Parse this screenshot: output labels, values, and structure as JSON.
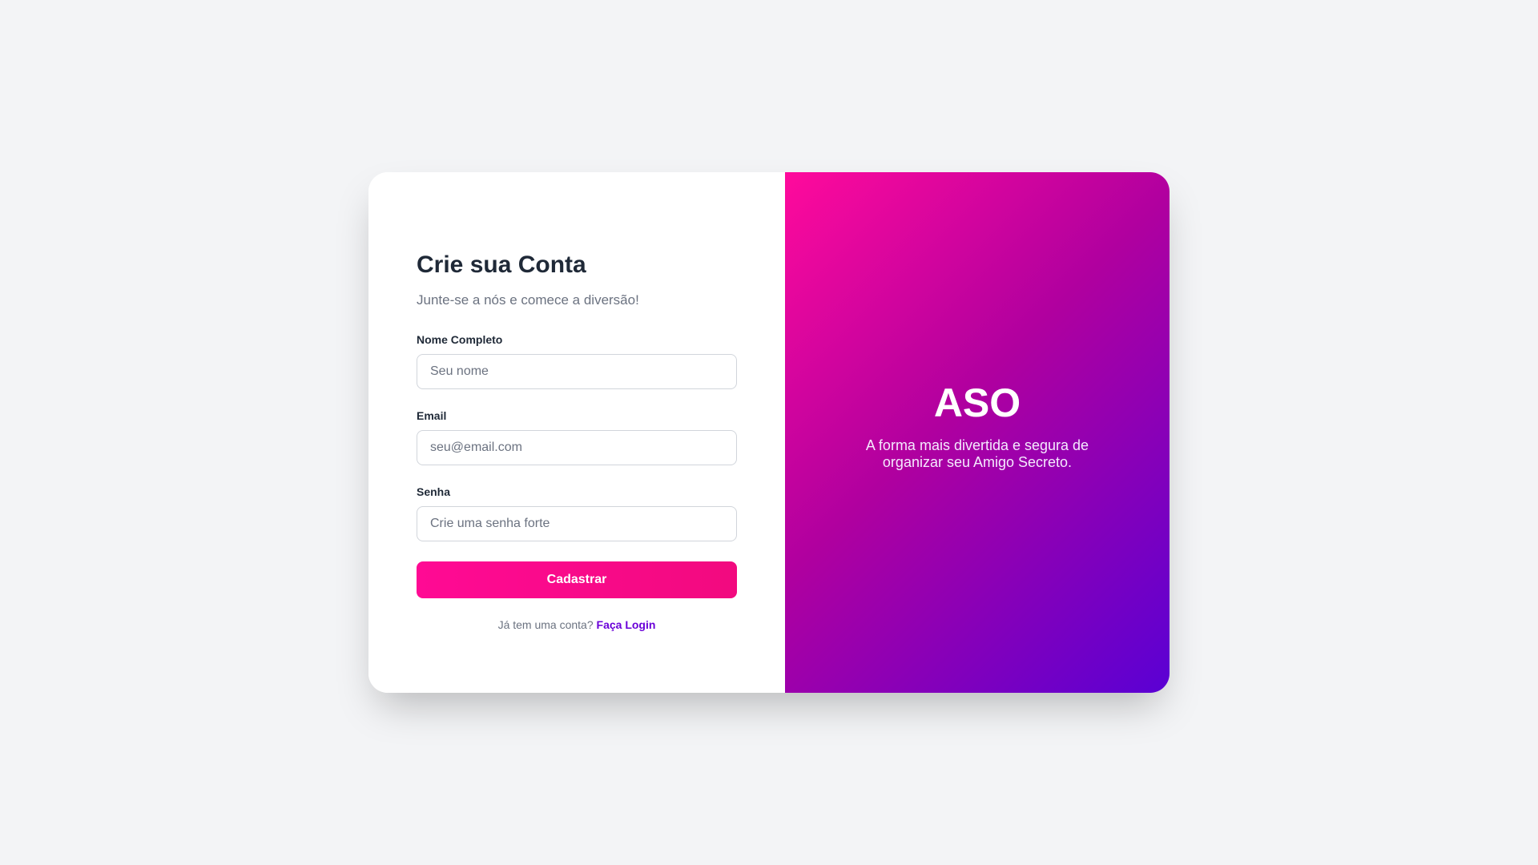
{
  "form": {
    "title": "Crie sua Conta",
    "subtitle": "Junte-se a nós e comece a diversão!",
    "fields": [
      {
        "label": "Nome Completo",
        "placeholder": "Seu nome",
        "value": ""
      },
      {
        "label": "Email",
        "placeholder": "seu@email.com",
        "value": ""
      },
      {
        "label": "Senha",
        "placeholder": "Crie uma senha forte",
        "value": ""
      }
    ],
    "submit_label": "Cadastrar",
    "login_prompt": "Já tem uma conta?",
    "login_link": "Faça Login"
  },
  "brand": {
    "name": "ASO",
    "tagline": "A forma mais divertida e segura de organizar seu Amigo Secreto."
  },
  "colors": {
    "background": "#f3f4f6",
    "primary_pink": "#ff0a94",
    "link_purple": "#6a00d8",
    "gradient_start": "#ff0a9c",
    "gradient_end": "#5a00d4"
  }
}
